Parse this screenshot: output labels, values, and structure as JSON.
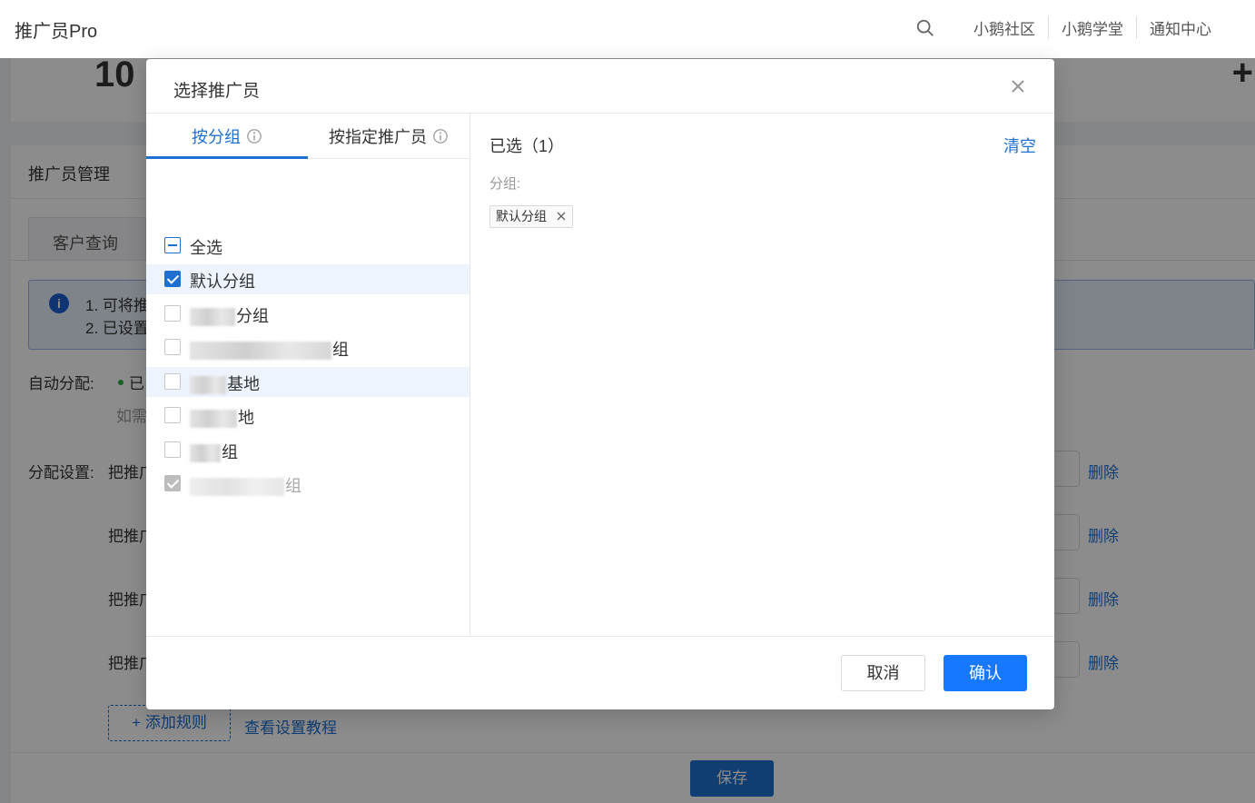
{
  "app": {
    "title": "推广员Pro"
  },
  "top_nav": {
    "items": [
      "小鹅社区",
      "小鹅学堂",
      "通知中心"
    ]
  },
  "stats": {
    "partial_number": "10"
  },
  "panel": {
    "title": "推广员管理",
    "tab": "客户查询",
    "notice": {
      "line1": "1. 可将推",
      "line2": "2. 已设置"
    },
    "auto_assign_label": "自动分配:",
    "auto_assign_status": "已",
    "hint": "如需",
    "rules_label": "分配设置:",
    "rule_prefix": "把推广",
    "delete_label": "删除",
    "add_rule": "+ 添加规则",
    "tutorial_link": "查看设置教程",
    "save": "保存"
  },
  "modal": {
    "title": "选择推广员",
    "tabs": [
      {
        "label": "按分组",
        "active": true
      },
      {
        "label": "按指定推广员",
        "active": false
      }
    ],
    "select_all": "全选",
    "groups": [
      {
        "label": "默认分组",
        "state": "checked"
      },
      {
        "label": "分组",
        "state": "unchecked"
      },
      {
        "label": "组",
        "state": "unchecked"
      },
      {
        "label": "基地",
        "state": "unchecked"
      },
      {
        "label": "地",
        "state": "unchecked"
      },
      {
        "label": "组",
        "state": "unchecked"
      },
      {
        "label": "组",
        "state": "disabled-checked"
      }
    ],
    "selected_title": "已选（1）",
    "clear": "清空",
    "group_label": "分组:",
    "selected_tags": [
      "默认分组"
    ],
    "cancel": "取消",
    "confirm": "确认"
  },
  "colors": {
    "primary": "#1677ff",
    "link": "#1e6fd0"
  }
}
